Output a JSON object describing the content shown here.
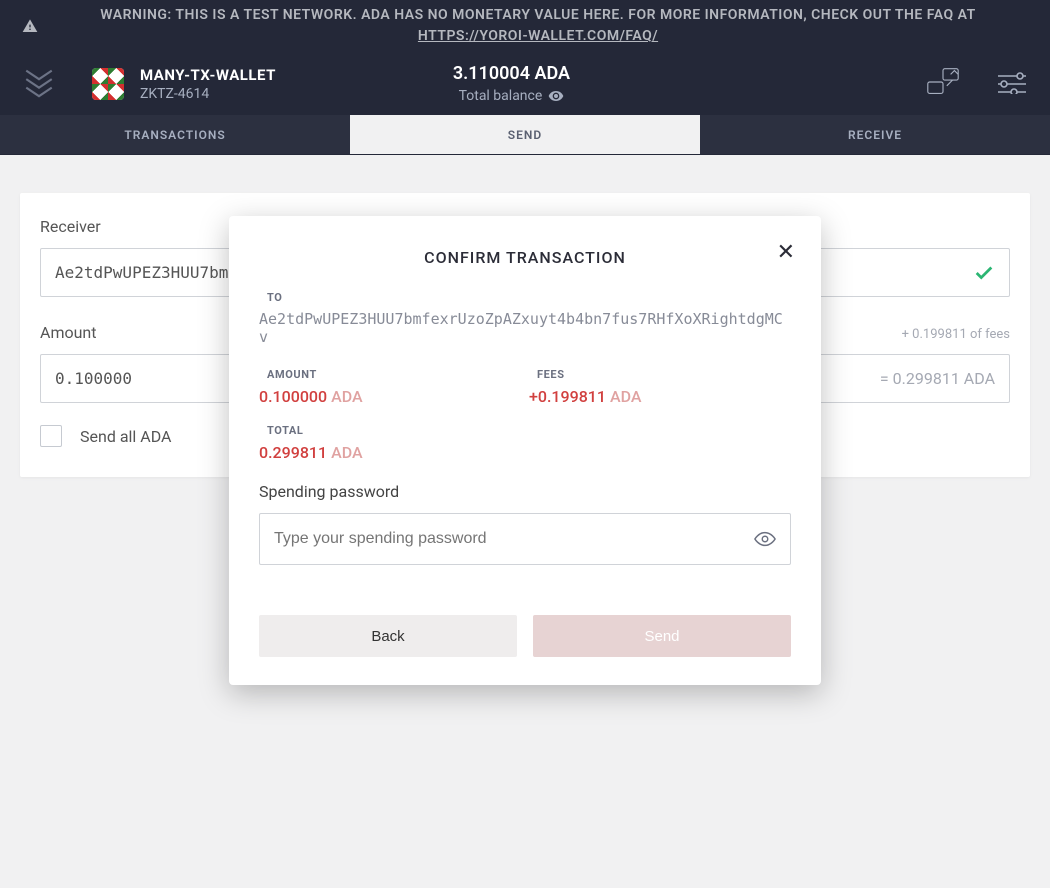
{
  "warning": {
    "text_prefix": "WARNING: THIS IS A TEST NETWORK. ADA HAS NO MONETARY VALUE HERE. FOR MORE INFORMATION, CHECK OUT THE FAQ AT ",
    "link": "HTTPS://YOROI-WALLET.COM/FAQ/"
  },
  "header": {
    "wallet_name": "MANY-TX-WALLET",
    "wallet_plate": "ZKTZ-4614",
    "balance": "3.110004 ADA",
    "balance_label": "Total balance"
  },
  "tabs": {
    "transactions": "TRANSACTIONS",
    "send": "SEND",
    "receive": "RECEIVE"
  },
  "form": {
    "receiver_label": "Receiver",
    "receiver_value": "Ae2tdPwUPEZ3HUU7bm",
    "amount_label": "Amount",
    "amount_value": "0.100000",
    "fees_hint": "+ 0.199811 of fees",
    "amount_equals": "= 0.299811 ADA",
    "send_all_label": "Send all ADA"
  },
  "modal": {
    "title": "CONFIRM TRANSACTION",
    "to_label": "TO",
    "to_value": "Ae2tdPwUPEZ3HUU7bmfexrUzoZpAZxuyt4b4bn7fus7RHfXoXRightdgMCv",
    "amount_label": "AMOUNT",
    "amount_value": "0.100000",
    "amount_unit": "ADA",
    "fees_label": "FEES",
    "fees_value": "+0.199811",
    "fees_unit": "ADA",
    "total_label": "TOTAL",
    "total_value": "0.299811",
    "total_unit": "ADA",
    "password_label": "Spending password",
    "password_placeholder": "Type your spending password",
    "back_label": "Back",
    "send_label": "Send"
  }
}
